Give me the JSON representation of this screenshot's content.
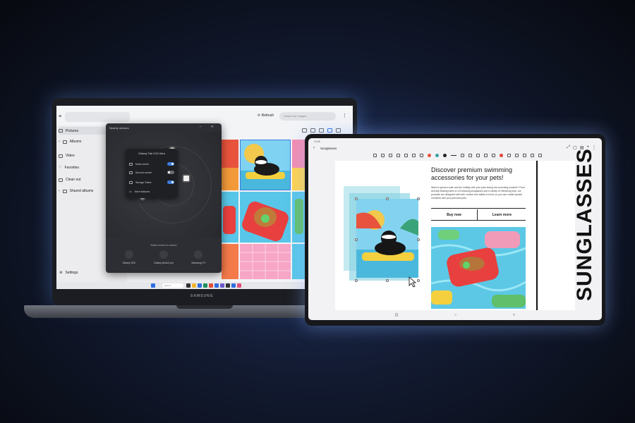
{
  "laptop": {
    "brand": "SAMSUNG",
    "explorer": {
      "refresh_label": "Refresh",
      "search_placeholder": "Search for images",
      "sidebar": [
        {
          "label": "Pictures",
          "icon": "image-icon",
          "active": true
        },
        {
          "label": "Albums",
          "icon": "album-icon",
          "active": false
        },
        {
          "label": "Video",
          "icon": "video-icon",
          "active": false
        },
        {
          "label": "Favorites",
          "icon": "heart-icon",
          "active": false
        },
        {
          "label": "Clean out",
          "icon": "trash-icon",
          "active": false
        },
        {
          "label": "Shared albums",
          "icon": "people-icon",
          "active": false
        }
      ],
      "settings_label": "Settings",
      "taskbar_search": "Search"
    },
    "nearby_dialog": {
      "title": "Nearby devices",
      "popup_title": "Galaxy Tab S10 Ultra",
      "options": [
        {
          "label": "Multi control",
          "enabled": true
        },
        {
          "label": "Second screen",
          "enabled": false
        },
        {
          "label": "Storage Share",
          "enabled": true
        },
        {
          "label": "More features",
          "enabled": null
        }
      ],
      "status": "Multi control is active",
      "devices": [
        "Galaxy S25",
        "Galaxy Buds3 pro",
        "Samsung TV"
      ]
    }
  },
  "tablet": {
    "status_time": "12:45",
    "doc_title": "Sunglasses",
    "headline": "Discover premium swimming accessories for your pets!",
    "body": "Want to spend a safe and fun holiday with your pets during the scorching summer? From anti-slip floating tubes to UV-blocking sunglasses and a variety of refreshing toys, our products are designed with both comfort and safety in mind, so you can create special moments with your precious pets.",
    "buy_label": "Buy now",
    "learn_label": "Learn more",
    "vertical_title": "SUNGLASSES",
    "nav": [
      "|||",
      "○",
      "<"
    ]
  },
  "colors": {
    "accent": "#3d7be0",
    "pool": "#58c6e8",
    "float_red": "#e8403f",
    "float_green": "#5fbf6a"
  }
}
